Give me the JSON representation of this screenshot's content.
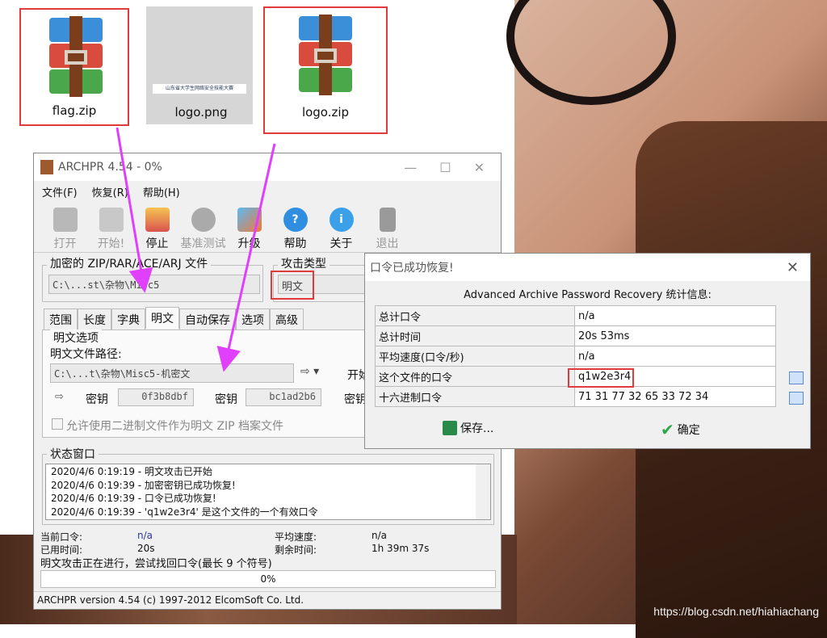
{
  "desktop": {
    "files": [
      {
        "label": "flag.zip"
      },
      {
        "label": "logo.png"
      },
      {
        "label": "logo.zip"
      }
    ],
    "logo_strip_text": "山东省大学生网络安全技能大赛",
    "watermark": "https://blog.csdn.net/hiahiachang"
  },
  "archpr": {
    "title": "ARCHPR 4.54 - 0%",
    "menu": [
      "文件(F)",
      "恢复(R)",
      "帮助(H)"
    ],
    "toolbar": [
      {
        "label": "打开",
        "icon": "open-icon",
        "enabled": false
      },
      {
        "label": "开始!",
        "icon": "start-icon",
        "enabled": false
      },
      {
        "label": "停止",
        "icon": "stop-icon",
        "enabled": true
      },
      {
        "label": "基准测试",
        "icon": "benchmark-icon",
        "enabled": false
      },
      {
        "label": "升级",
        "icon": "upgrade-icon",
        "enabled": true
      },
      {
        "label": "帮助",
        "icon": "help-icon",
        "enabled": true
      },
      {
        "label": "关于",
        "icon": "about-icon",
        "enabled": true
      },
      {
        "label": "退出",
        "icon": "exit-icon",
        "enabled": false
      }
    ],
    "encrypted_file_label": "加密的 ZIP/RAR/ACE/ARJ 文件",
    "encrypted_file_path": "C:\\...st\\杂物\\Misc5",
    "attack_type_label": "攻击类型",
    "attack_type_value": "明文",
    "tabs": [
      "范围",
      "长度",
      "字典",
      "明文",
      "自动保存",
      "选项",
      "高级"
    ],
    "active_tab": "明文",
    "plaintext_options_label": "明文选项",
    "plaintext_path_label": "明文文件路径:",
    "plaintext_path": "C:\\...t\\杂物\\Misc5-机密文",
    "start_label": "开始",
    "key_label": "密钥",
    "key1": "0f3b8dbf",
    "key2": "bc1ad2b6",
    "allow_binary_label": "允许使用二进制文件作为明文 ZIP 档案文件",
    "status_window_label": "状态窗口",
    "log": [
      "2020/4/6 0:19:19 - 明文攻击已开始",
      "2020/4/6 0:19:39 - 加密密钥已成功恢复!",
      "2020/4/6 0:19:39 - 口令已成功恢复!",
      "2020/4/6 0:19:39 - 'q1w2e3r4' 是这个文件的一个有效口令"
    ],
    "current_password_label": "当前口令:",
    "current_password": "n/a",
    "avg_speed_label": "平均速度:",
    "avg_speed": "n/a",
    "elapsed_label": "已用时间:",
    "elapsed": "20s",
    "remaining_label": "剩余时间:",
    "remaining": "1h 39m 37s",
    "progress_text": "明文攻击正在进行，尝试找回口令(最长 9 个符号)",
    "progress_percent": "0%",
    "progress_value": 0,
    "version": "ARCHPR version 4.54 (c) 1997-2012 ElcomSoft Co. Ltd."
  },
  "dialog": {
    "title": "口令已成功恢复!",
    "header": "Advanced Archive Password Recovery 统计信息:",
    "rows": [
      {
        "key": "总计口令",
        "value": "n/a"
      },
      {
        "key": "总计时间",
        "value": "20s 53ms"
      },
      {
        "key": "平均速度(口令/秒)",
        "value": "n/a"
      },
      {
        "key": "这个文件的口令",
        "value": "q1w2e3r4"
      },
      {
        "key": "十六进制口令",
        "value": "71 31 77 32 65 33 72 34"
      }
    ],
    "save_label": "保存...",
    "ok_label": "确定"
  },
  "colors": {
    "highlight": "#e23a3a",
    "arrow": "#e040fb",
    "link_blue": "#2b3a9a"
  }
}
